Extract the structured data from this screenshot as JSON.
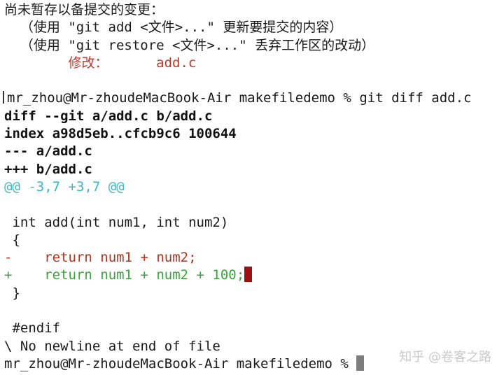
{
  "status": {
    "unstaged_header": "尚未暂存以备提交的变更：",
    "hint_add": "  （使用 \"git add <文件>...\" 更新要提交的内容）",
    "hint_restore": "  （使用 \"git restore <文件>...\" 丢弃工作区的改动）",
    "modified_label": "修改：",
    "modified_file": "add.c"
  },
  "command": {
    "prompt": "mr_zhou@Mr-zhoudeMacBook-Air makefiledemo % ",
    "text": "git diff add.c"
  },
  "diff": {
    "header_git": "diff --git a/add.c b/add.c",
    "header_index": "index a98d5eb..cfcb9c6 100644",
    "header_old": "--- a/add.c",
    "header_new": "+++ b/add.c",
    "hunk": "@@ -3,7 +3,7 @@",
    "context_1": " int add(int num1, int num2)",
    "context_2": " {",
    "removed_line": "-    return num1 + num2;",
    "added_line": "+    return num1 + num2 + 100;",
    "context_3": " }",
    "context_4": " #endif",
    "no_newline": "\\ No newline at end of file"
  },
  "final_prompt": "mr_zhou@Mr-zhoudeMacBook-Air makefiledemo % ",
  "watermark": "知乎 @卷客之路",
  "colors": {
    "removed": "#b5341d",
    "added": "#3aa63a",
    "hunk": "#3fb6c8",
    "cursor_red": "#a11010",
    "cursor_gray": "#7d7d7d"
  }
}
